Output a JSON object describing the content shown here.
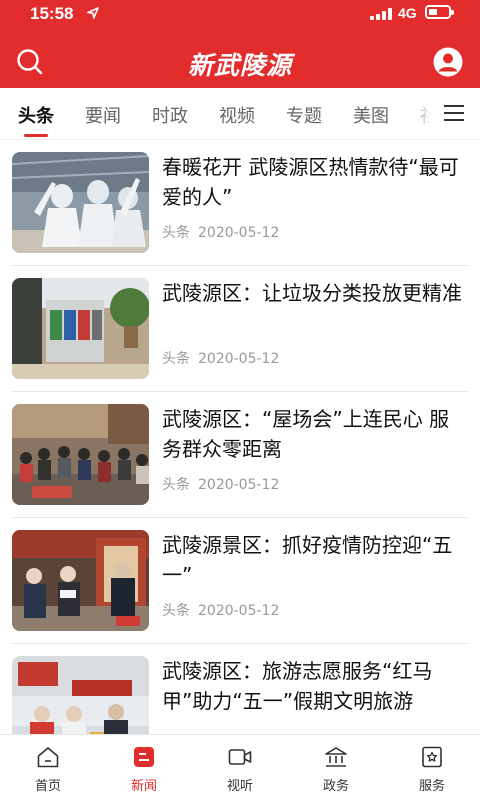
{
  "status_bar": {
    "time": "15:58",
    "network": "4G",
    "battery_level": 0.45
  },
  "header": {
    "title": "新武陵源"
  },
  "tabs": [
    {
      "label": "头条",
      "active": true
    },
    {
      "label": "要闻",
      "active": false
    },
    {
      "label": "时政",
      "active": false
    },
    {
      "label": "视频",
      "active": false
    },
    {
      "label": "专题",
      "active": false
    },
    {
      "label": "美图",
      "active": false
    },
    {
      "label": "社",
      "active": false
    }
  ],
  "news": [
    {
      "title": "春暖花开 武陵源区热情款待“最可爱的人”",
      "source": "头条",
      "date": "2020-05-12"
    },
    {
      "title": "武陵源区：让垃圾分类投放更精准",
      "source": "头条",
      "date": "2020-05-12"
    },
    {
      "title": "武陵源区：“屋场会”上连民心 服务群众零距离",
      "source": "头条",
      "date": "2020-05-12"
    },
    {
      "title": "武陵源景区：抓好疫情防控迎“五一”",
      "source": "头条",
      "date": "2020-05-12"
    },
    {
      "title": "武陵源区：旅游志愿服务“红马甲”助力“五一”假期文明旅游",
      "source": "",
      "date": ""
    }
  ],
  "bottom_nav": [
    {
      "label": "首页",
      "icon": "home-icon",
      "active": false
    },
    {
      "label": "新闻",
      "icon": "news-icon",
      "active": true
    },
    {
      "label": "视听",
      "icon": "video-icon",
      "active": false
    },
    {
      "label": "政务",
      "icon": "government-icon",
      "active": false
    },
    {
      "label": "服务",
      "icon": "service-icon",
      "active": false
    }
  ],
  "colors": {
    "brand_red": "#e32c2c",
    "text_primary": "#111111",
    "text_meta": "#999999"
  }
}
